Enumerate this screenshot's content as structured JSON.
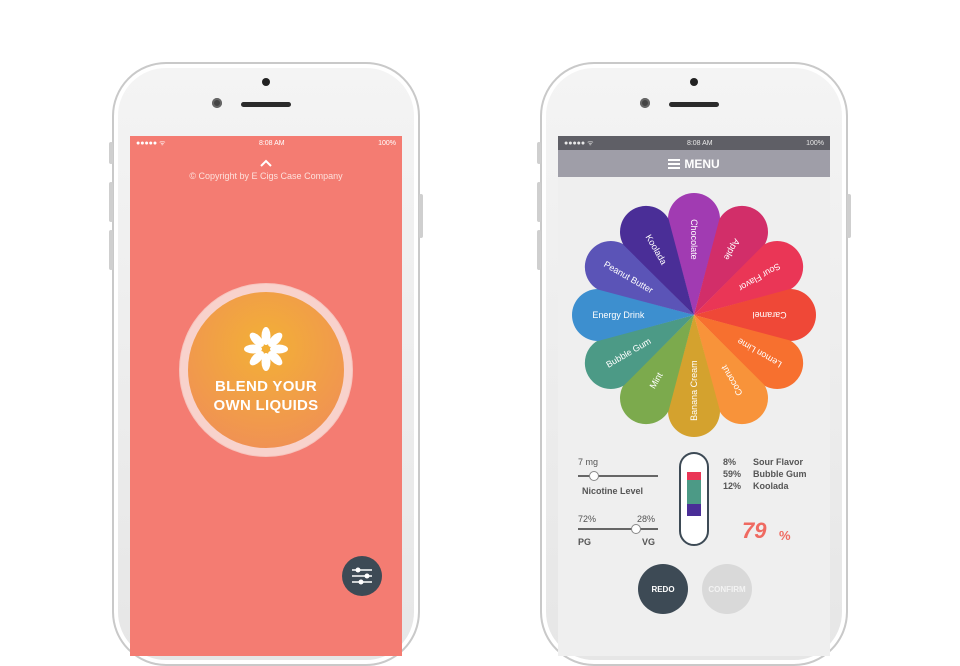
{
  "left_phone": {
    "status": {
      "carrier": "●●●●● ᯤ",
      "time": "8:08 AM",
      "battery": "100%"
    },
    "copyright": "© Copyright by E Cigs Case Company",
    "blend_title_line1": "BLEND YOUR",
    "blend_title_line2": "OWN LIQUIDS",
    "icons": {
      "up": "chevron-up-icon",
      "burst": "asterisk-flower-icon",
      "settings": "sliders-icon"
    },
    "colors": {
      "background": "#f47c72",
      "button_start": "#f2b036",
      "button_end": "#f08a5b"
    }
  },
  "right_phone": {
    "status": {
      "carrier": "●●●●● ᯤ",
      "time": "8:08 AM",
      "battery": "100%"
    },
    "menu_label": "MENU",
    "flavors": [
      {
        "name": "Chocolate",
        "color": "#a13bb2"
      },
      {
        "name": "Apple",
        "color": "#d22e69"
      },
      {
        "name": "Sour Flavor",
        "color": "#ea3656"
      },
      {
        "name": "Caramel",
        "color": "#ef4837"
      },
      {
        "name": "Lemon Lime",
        "color": "#f7702f"
      },
      {
        "name": "Coconut",
        "color": "#f8933a"
      },
      {
        "name": "Banana Cream",
        "color": "#d4a22e"
      },
      {
        "name": "Mint",
        "color": "#7caa4d"
      },
      {
        "name": "Bubble Gum",
        "color": "#4c9a86"
      },
      {
        "name": "Energy Drink",
        "color": "#3d8fcf"
      },
      {
        "name": "Peanut Butter",
        "color": "#5b54b7"
      },
      {
        "name": "Koolada",
        "color": "#4a2e97"
      }
    ],
    "nicotine": {
      "value_label": "7 mg",
      "title": "Nicotine Level",
      "level": 0.2
    },
    "ratio": {
      "pg_value": "72%",
      "vg_value": "28%",
      "pg_label": "PG",
      "vg_label": "VG",
      "pg_fraction": 0.72
    },
    "blend": [
      {
        "percent": "8%",
        "flavor": "Sour Flavor",
        "color": "#ea3656"
      },
      {
        "percent": "59%",
        "flavor": "Bubble Gum",
        "color": "#4c9a86"
      },
      {
        "percent": "12%",
        "flavor": "Koolada",
        "color": "#4a2e97"
      }
    ],
    "fill_percent_value": "79",
    "fill_percent_sign": "%",
    "buttons": {
      "redo": "REDO",
      "confirm": "CONFIRM"
    },
    "icons": {
      "menu": "hamburger-icon"
    }
  }
}
